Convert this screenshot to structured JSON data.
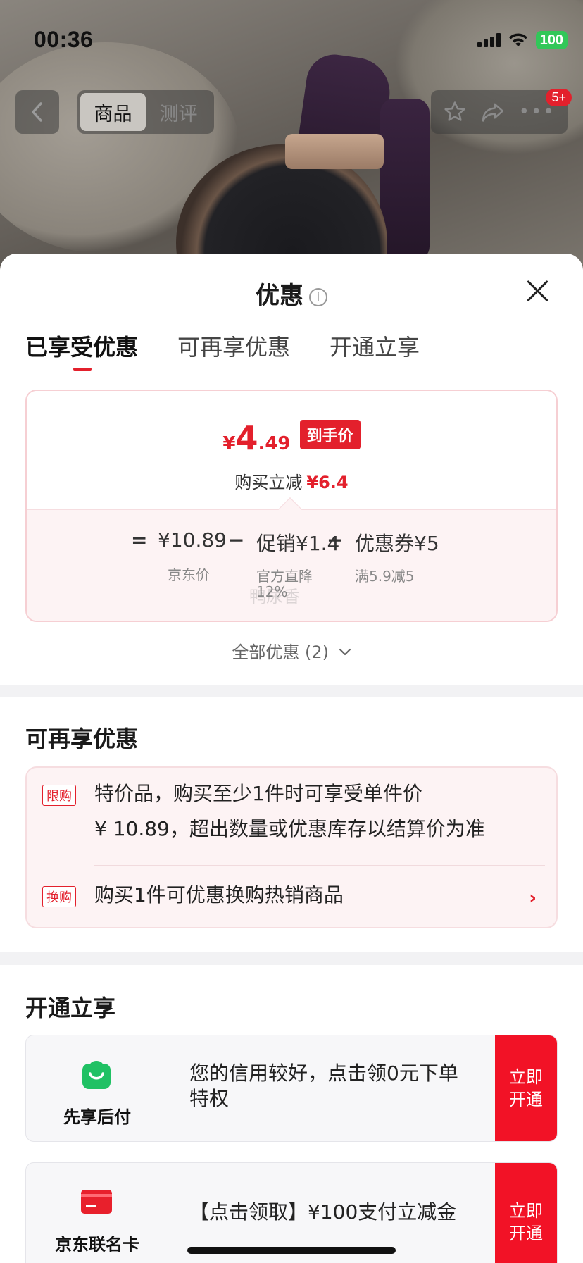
{
  "status_bar": {
    "time": "00:36",
    "battery": "100"
  },
  "top_nav": {
    "tabs": [
      {
        "label": "商品",
        "active": true
      },
      {
        "label": "测评",
        "active": false
      }
    ],
    "badge": "5+"
  },
  "sheet": {
    "title": "优惠",
    "tabs": [
      {
        "label": "已享受优惠",
        "active": true
      },
      {
        "label": "可再享优惠",
        "active": false
      },
      {
        "label": "开通立享",
        "active": false
      }
    ],
    "price": {
      "currency": "¥",
      "integer": "4",
      "decimal": ".49",
      "tag": "到手价",
      "saving_label": "购买立减",
      "saving_value": "¥6.4"
    },
    "formula": {
      "equals": "=",
      "base": "¥10.89",
      "minus1": "−",
      "promo": "促销¥1.4",
      "minus2": "−",
      "coupon": "优惠券¥5",
      "base_caption": "京东价",
      "promo_caption_1": "官方直降",
      "promo_caption_2": "12%",
      "coupon_caption": "满5.9减5",
      "watermark": "鸭尿香"
    },
    "all_discount": "全部优惠 (2)",
    "more_section": {
      "title": "可再享优惠",
      "items": [
        {
          "tag": "限购",
          "line1": "特价品，购买至少1件时可享受单件价",
          "line2": "¥ 10.89，超出数量或优惠库存以结算价为准"
        },
        {
          "tag": "换购",
          "line1": "购买1件可优惠换购热销商品"
        }
      ]
    },
    "open_section": {
      "title": "开通立享",
      "cards": [
        {
          "label": "先享后付",
          "desc": "您的信用较好，点击领0元下单特权",
          "button": "立即开通",
          "icon_color": "#20c164"
        },
        {
          "label": "京东联名卡",
          "desc": "【点击领取】¥100支付立减金",
          "button": "立即开通",
          "icon_color": "#e8202c"
        }
      ]
    }
  },
  "colors": {
    "accent": "#e3202c",
    "button": "#f21226",
    "battery": "#32c759"
  }
}
